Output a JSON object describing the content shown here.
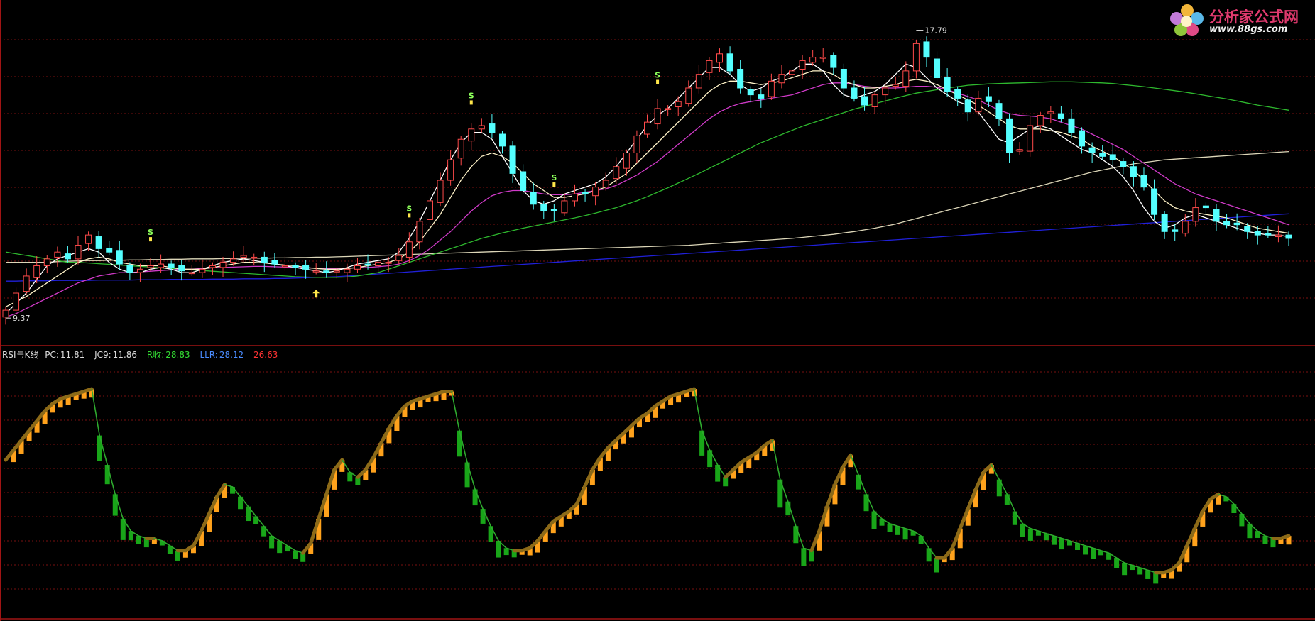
{
  "logo": {
    "title": "分析家公式网",
    "url": "www.88gs.com"
  },
  "colors": {
    "background": "#000000",
    "grid": "#7a1010",
    "divider": "#a01414",
    "candle_up": "#ff4a4a",
    "candle_down": "#54ffff",
    "rsi_up": "#ffa21c",
    "rsi_down": "#19a619",
    "rsi_line_up": "#8c6a18",
    "rsi_line_down": "#2eaa2e",
    "ma_fast": "#ffffff",
    "ma_mid": "#fff3c8",
    "ma_slow": "#d03ac8",
    "ma_green": "#2eb82e",
    "ma_long": "#dcd6b8",
    "ma_blue": "#2020d8"
  },
  "price_panel": {
    "high_label": "17.79",
    "low_label": "9.37",
    "signal_marks": [
      "S",
      "S",
      "S",
      "S",
      "S"
    ]
  },
  "indicator_panel": {
    "name": "RSI与K线",
    "items": [
      {
        "label": "PC:",
        "value": "11.81",
        "color": "#dcdcdc"
      },
      {
        "label": "JC9:",
        "value": "11.86",
        "color": "#dcdcdc"
      },
      {
        "label": "R收:",
        "value": "28.83",
        "color": "#33dd33"
      },
      {
        "label": "LLR:",
        "value": "28.12",
        "color": "#4a8cff"
      },
      {
        "label": "",
        "value": "26.63",
        "color": "#ff3333"
      }
    ]
  },
  "chart_data": [
    {
      "type": "candlestick",
      "title": "",
      "ylim": [
        9.0,
        18.3
      ],
      "y_max_label": 17.79,
      "y_min_label": 9.37,
      "close": [
        9.6,
        10.1,
        10.6,
        10.9,
        11.1,
        11.3,
        11.1,
        11.5,
        11.8,
        11.4,
        11.3,
        10.95,
        10.7,
        10.8,
        10.9,
        10.95,
        10.85,
        10.75,
        10.7,
        10.8,
        10.9,
        11.0,
        11.1,
        11.2,
        11.15,
        11.0,
        10.95,
        10.9,
        10.85,
        10.8,
        10.75,
        10.7,
        10.75,
        10.8,
        10.9,
        10.95,
        11.0,
        11.0,
        11.2,
        11.6,
        12.2,
        12.8,
        13.4,
        14.0,
        14.6,
        14.9,
        15.0,
        14.8,
        14.4,
        13.6,
        13.1,
        12.7,
        12.5,
        12.5,
        12.8,
        13.0,
        13.0,
        13.2,
        13.4,
        13.8,
        14.2,
        14.7,
        15.1,
        15.5,
        15.5,
        15.7,
        16.1,
        16.5,
        16.9,
        17.1,
        16.6,
        16.1,
        15.9,
        15.8,
        16.3,
        16.5,
        16.6,
        16.9,
        17.0,
        17.0,
        16.7,
        16.1,
        15.8,
        15.6,
        15.9,
        16.1,
        16.2,
        16.6,
        17.4,
        17.0,
        16.4,
        16.0,
        15.8,
        15.4,
        15.8,
        15.7,
        15.2,
        14.2,
        14.3,
        15.0,
        15.3,
        15.4,
        15.2,
        14.8,
        14.4,
        14.2,
        14.1,
        14.0,
        13.8,
        13.5,
        13.2,
        12.4,
        11.9,
        11.9,
        12.2,
        12.6,
        12.6,
        12.2,
        12.1,
        12.1,
        11.9,
        11.8,
        11.8,
        11.8,
        11.7
      ],
      "ma_fast": [
        9.5,
        9.8,
        10.1,
        10.5,
        10.9,
        11.1,
        11.2,
        11.3,
        11.4,
        11.3,
        11.0,
        10.8,
        10.7,
        10.7,
        10.8,
        10.85,
        10.8,
        10.7,
        10.7,
        10.8,
        10.9,
        11.0,
        11.05,
        11.1,
        11.05,
        11.0,
        10.95,
        10.9,
        10.85,
        10.8,
        10.75,
        10.7,
        10.75,
        10.85,
        10.95,
        11.0,
        11.05,
        11.1,
        11.3,
        11.7,
        12.2,
        12.8,
        13.4,
        14.0,
        14.5,
        14.8,
        14.8,
        14.6,
        14.1,
        13.6,
        13.1,
        12.8,
        12.7,
        12.8,
        13.0,
        13.1,
        13.2,
        13.3,
        13.5,
        13.8,
        14.2,
        14.6,
        15.0,
        15.3,
        15.5,
        15.8,
        16.1,
        16.4,
        16.7,
        16.7,
        16.5,
        16.2,
        16.0,
        16.1,
        16.3,
        16.4,
        16.6,
        16.8,
        16.8,
        16.6,
        16.2,
        15.9,
        15.8,
        15.9,
        16.0,
        16.2,
        16.5,
        16.8,
        16.7,
        16.4,
        16.1,
        15.9,
        15.7,
        15.6,
        15.4,
        15.0,
        14.6,
        14.5,
        14.7,
        14.9,
        15.0,
        14.9,
        14.7,
        14.5,
        14.3,
        14.2,
        14.0,
        13.8,
        13.5,
        13.1,
        12.6,
        12.2,
        12.0,
        12.1,
        12.3,
        12.4,
        12.3,
        12.2,
        12.1,
        12.0,
        11.9,
        11.85,
        11.8,
        11.8,
        11.75
      ],
      "ma_mid": [
        9.7,
        9.85,
        10.0,
        10.2,
        10.4,
        10.6,
        10.8,
        11.0,
        11.1,
        11.15,
        11.1,
        11.0,
        10.95,
        10.9,
        10.9,
        10.9,
        10.85,
        10.8,
        10.8,
        10.8,
        10.85,
        10.9,
        10.95,
        11.0,
        11.0,
        10.98,
        10.95,
        10.92,
        10.9,
        10.85,
        10.82,
        10.8,
        10.8,
        10.82,
        10.85,
        10.9,
        10.95,
        11.0,
        11.1,
        11.3,
        11.6,
        12.0,
        12.4,
        12.9,
        13.4,
        13.8,
        14.1,
        14.2,
        14.1,
        13.9,
        13.6,
        13.3,
        13.1,
        12.9,
        12.9,
        12.95,
        13.0,
        13.1,
        13.2,
        13.4,
        13.6,
        13.9,
        14.2,
        14.5,
        14.8,
        15.1,
        15.4,
        15.7,
        16.0,
        16.2,
        16.3,
        16.3,
        16.25,
        16.2,
        16.25,
        16.3,
        16.4,
        16.5,
        16.6,
        16.6,
        16.5,
        16.3,
        16.2,
        16.1,
        16.1,
        16.15,
        16.2,
        16.3,
        16.35,
        16.3,
        16.2,
        16.05,
        15.9,
        15.75,
        15.6,
        15.4,
        15.2,
        15.0,
        14.9,
        14.9,
        14.9,
        14.85,
        14.8,
        14.7,
        14.6,
        14.4,
        14.25,
        14.1,
        13.9,
        13.7,
        13.4,
        13.1,
        12.8,
        12.6,
        12.5,
        12.45,
        12.4,
        12.35,
        12.3,
        12.2,
        12.1,
        12.0,
        11.95,
        11.9,
        11.85
      ],
      "ma_slow": [
        9.4,
        9.5,
        9.65,
        9.8,
        9.95,
        10.1,
        10.25,
        10.4,
        10.5,
        10.6,
        10.65,
        10.7,
        10.7,
        10.72,
        10.74,
        10.76,
        10.78,
        10.8,
        10.8,
        10.82,
        10.84,
        10.85,
        10.86,
        10.87,
        10.88,
        10.88,
        10.87,
        10.86,
        10.85,
        10.84,
        10.83,
        10.82,
        10.82,
        10.83,
        10.84,
        10.85,
        10.87,
        10.9,
        10.95,
        11.05,
        11.2,
        11.4,
        11.65,
        11.9,
        12.2,
        12.5,
        12.75,
        12.95,
        13.05,
        13.1,
        13.1,
        13.05,
        13.0,
        12.98,
        12.98,
        13.0,
        13.05,
        13.1,
        13.15,
        13.25,
        13.4,
        13.55,
        13.75,
        13.95,
        14.2,
        14.45,
        14.7,
        14.95,
        15.2,
        15.4,
        15.55,
        15.65,
        15.7,
        15.75,
        15.8,
        15.85,
        15.9,
        16.0,
        16.1,
        16.2,
        16.25,
        16.25,
        16.2,
        16.15,
        16.12,
        16.1,
        16.1,
        16.12,
        16.15,
        16.15,
        16.12,
        16.05,
        15.95,
        15.85,
        15.75,
        15.6,
        15.45,
        15.35,
        15.3,
        15.28,
        15.25,
        15.2,
        15.1,
        15.0,
        14.9,
        14.75,
        14.6,
        14.45,
        14.3,
        14.1,
        13.9,
        13.7,
        13.5,
        13.3,
        13.15,
        13.0,
        12.9,
        12.8,
        12.7,
        12.6,
        12.5,
        12.4,
        12.3,
        12.2,
        12.1
      ],
      "ma_green": [
        11.3,
        11.25,
        11.2,
        11.15,
        11.1,
        11.05,
        11.0,
        11.0,
        10.98,
        10.96,
        10.94,
        10.92,
        10.9,
        10.88,
        10.86,
        10.84,
        10.82,
        10.8,
        10.78,
        10.76,
        10.74,
        10.72,
        10.7,
        10.68,
        10.66,
        10.64,
        10.62,
        10.6,
        10.58,
        10.57,
        10.56,
        10.56,
        10.56,
        10.57,
        10.6,
        10.65,
        10.7,
        10.8,
        10.9,
        11.0,
        11.1,
        11.2,
        11.3,
        11.4,
        11.5,
        11.6,
        11.7,
        11.78,
        11.86,
        11.93,
        12.0,
        12.06,
        12.12,
        12.18,
        12.24,
        12.3,
        12.37,
        12.44,
        12.52,
        12.6,
        12.7,
        12.8,
        12.92,
        13.05,
        13.18,
        13.32,
        13.46,
        13.6,
        13.75,
        13.9,
        14.05,
        14.2,
        14.35,
        14.5,
        14.62,
        14.74,
        14.86,
        14.98,
        15.08,
        15.18,
        15.28,
        15.38,
        15.48,
        15.56,
        15.64,
        15.72,
        15.8,
        15.88,
        15.95,
        16.0,
        16.05,
        16.1,
        16.14,
        16.18,
        16.2,
        16.22,
        16.23,
        16.24,
        16.25,
        16.26,
        16.27,
        16.28,
        16.28,
        16.28,
        16.27,
        16.26,
        16.25,
        16.23,
        16.2,
        16.17,
        16.14,
        16.1,
        16.06,
        16.02,
        15.98,
        15.93,
        15.88,
        15.83,
        15.78,
        15.72,
        15.66,
        15.6,
        15.55,
        15.5,
        15.45
      ],
      "ma_long": [
        11.0,
        11.0,
        11.0,
        11.0,
        11.0,
        11.02,
        11.03,
        11.04,
        11.05,
        11.05,
        11.06,
        11.06,
        11.07,
        11.07,
        11.08,
        11.08,
        11.09,
        11.09,
        11.1,
        11.1,
        11.1,
        11.11,
        11.11,
        11.12,
        11.12,
        11.12,
        11.13,
        11.13,
        11.14,
        11.14,
        11.15,
        11.15,
        11.16,
        11.17,
        11.18,
        11.19,
        11.2,
        11.21,
        11.22,
        11.23,
        11.24,
        11.25,
        11.26,
        11.27,
        11.28,
        11.29,
        11.3,
        11.31,
        11.32,
        11.33,
        11.34,
        11.35,
        11.36,
        11.37,
        11.38,
        11.39,
        11.4,
        11.41,
        11.42,
        11.43,
        11.44,
        11.45,
        11.46,
        11.47,
        11.48,
        11.49,
        11.5,
        11.52,
        11.54,
        11.56,
        11.58,
        11.6,
        11.62,
        11.64,
        11.66,
        11.68,
        11.7,
        11.73,
        11.76,
        11.79,
        11.82,
        11.86,
        11.9,
        11.95,
        12.0,
        12.06,
        12.12,
        12.2,
        12.28,
        12.36,
        12.44,
        12.52,
        12.6,
        12.68,
        12.76,
        12.84,
        12.92,
        13.0,
        13.08,
        13.16,
        13.24,
        13.32,
        13.4,
        13.48,
        13.56,
        13.64,
        13.7,
        13.76,
        13.82,
        13.88,
        13.92,
        13.96,
        14.0,
        14.02,
        14.04,
        14.06,
        14.08,
        14.1,
        14.12,
        14.14,
        14.16,
        14.18,
        14.2,
        14.22,
        14.24
      ],
      "ma_blue": [
        10.45,
        10.45,
        10.46,
        10.46,
        10.46,
        10.47,
        10.47,
        10.47,
        10.47,
        10.48,
        10.48,
        10.48,
        10.48,
        10.49,
        10.49,
        10.49,
        10.5,
        10.5,
        10.5,
        10.5,
        10.51,
        10.51,
        10.51,
        10.52,
        10.52,
        10.52,
        10.53,
        10.53,
        10.54,
        10.55,
        10.56,
        10.57,
        10.58,
        10.6,
        10.62,
        10.64,
        10.66,
        10.68,
        10.7,
        10.72,
        10.74,
        10.76,
        10.78,
        10.8,
        10.82,
        10.84,
        10.86,
        10.88,
        10.9,
        10.92,
        10.94,
        10.96,
        10.98,
        11.0,
        11.02,
        11.04,
        11.06,
        11.08,
        11.1,
        11.12,
        11.14,
        11.16,
        11.18,
        11.2,
        11.22,
        11.24,
        11.26,
        11.28,
        11.3,
        11.32,
        11.34,
        11.36,
        11.38,
        11.4,
        11.42,
        11.44,
        11.46,
        11.48,
        11.5,
        11.52,
        11.54,
        11.56,
        11.58,
        11.6,
        11.62,
        11.64,
        11.66,
        11.68,
        11.7,
        11.72,
        11.74,
        11.76,
        11.78,
        11.8,
        11.82,
        11.84,
        11.86,
        11.88,
        11.9,
        11.92,
        11.94,
        11.96,
        11.98,
        12.0,
        12.02,
        12.04,
        12.06,
        12.08,
        12.1,
        12.12,
        12.14,
        12.16,
        12.18,
        12.2,
        12.22,
        12.24,
        12.26,
        12.28,
        12.3,
        12.32,
        12.34,
        12.36,
        12.38,
        12.4,
        12.42
      ]
    },
    {
      "type": "bar",
      "title": "RSI与K线",
      "ylim": [
        0,
        100
      ],
      "values": [
        62,
        66,
        70,
        74,
        78,
        82,
        85,
        87,
        88,
        89,
        90,
        91,
        72,
        60,
        48,
        38,
        33,
        31,
        30,
        30,
        29,
        27,
        25,
        25,
        27,
        33,
        40,
        47,
        52,
        51,
        47,
        43,
        39,
        35,
        31,
        29,
        27,
        25,
        24,
        28,
        38,
        48,
        58,
        62,
        57,
        55,
        58,
        63,
        69,
        75,
        80,
        84,
        86,
        87,
        88,
        89,
        90,
        90,
        74,
        61,
        50,
        42,
        35,
        29,
        26,
        25,
        25,
        26,
        29,
        33,
        37,
        39,
        41,
        44,
        51,
        58,
        63,
        67,
        70,
        73,
        76,
        79,
        81,
        84,
        86,
        88,
        89,
        90,
        91,
        74,
        66,
        60,
        55,
        58,
        61,
        63,
        65,
        68,
        70,
        54,
        45,
        35,
        26,
        25,
        33,
        43,
        52,
        59,
        64,
        56,
        48,
        41,
        38,
        36,
        35,
        34,
        33,
        31,
        26,
        22,
        22,
        26,
        34,
        42,
        50,
        57,
        60,
        54,
        48,
        41,
        36,
        34,
        33,
        32,
        31,
        30,
        29,
        28,
        27,
        26,
        25,
        24,
        22,
        20,
        19,
        18,
        17,
        16,
        16,
        17,
        20,
        27,
        34,
        41,
        46,
        48,
        47,
        44,
        40,
        36,
        33,
        31,
        30,
        30,
        31
      ]
    }
  ]
}
